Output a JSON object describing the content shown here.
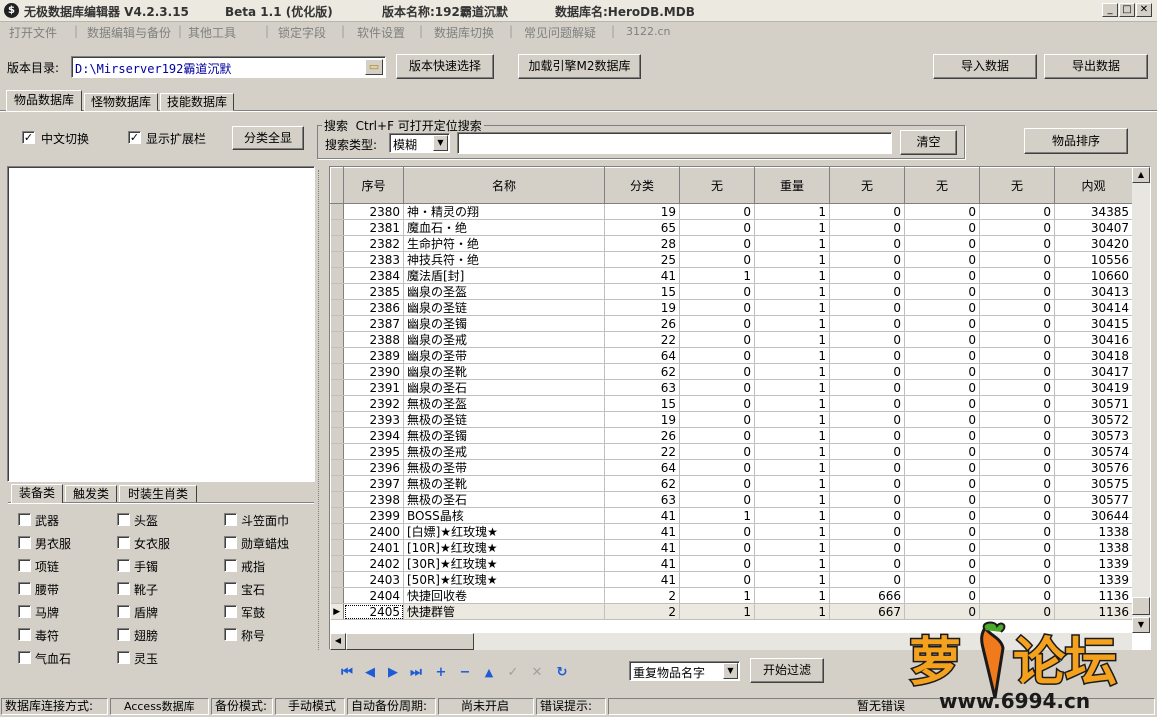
{
  "title": {
    "app_name": "无极数据库编辑器 V4.2.3.15",
    "beta": "Beta 1.1 (优化版)",
    "version_label": "版本名称:192霸道沉默",
    "db_label": "数据库名:HeroDB.MDB"
  },
  "menu": [
    "打开文件",
    "数据编辑与备份",
    "其他工具",
    "锁定字段",
    "软件设置",
    "数据库切换",
    "常见问题解疑",
    "3122.cn"
  ],
  "toolbar": {
    "dir_label": "版本目录:",
    "dir_value": "D:\\Mirserver192霸道沉默",
    "quick_select": "版本快速选择",
    "load_m2": "加载引擎M2数据库",
    "import": "导入数据",
    "export": "导出数据"
  },
  "tabs": [
    "物品数据库",
    "怪物数据库",
    "技能数据库"
  ],
  "options": {
    "chinese_switch": "中文切换",
    "show_ext": "显示扩展栏",
    "show_all": "分类全显"
  },
  "search": {
    "group_label": "搜索",
    "hint": "Ctrl+F 可打开定位搜索",
    "type_label": "搜索类型:",
    "type_value": "模糊",
    "query": "",
    "clear": "清空",
    "sort": "物品排序"
  },
  "category_tabs": [
    "装备类",
    "触发类",
    "时装生肖类"
  ],
  "categories": [
    [
      "武器",
      "头盔",
      "斗笠面巾"
    ],
    [
      "男衣服",
      "女衣服",
      "勋章蜡烛"
    ],
    [
      "项链",
      "手镯",
      "戒指"
    ],
    [
      "腰带",
      "靴子",
      "宝石"
    ],
    [
      "马牌",
      "盾牌",
      "军鼓"
    ],
    [
      "毒符",
      "翅膀",
      "称号"
    ],
    [
      "气血石",
      "灵玉",
      ""
    ]
  ],
  "grid": {
    "columns": [
      "序号",
      "名称",
      "分类",
      "无",
      "重量",
      "无",
      "无",
      "无",
      "内观"
    ],
    "rows": [
      [
        "2380",
        "神・精灵の翔",
        "19",
        "0",
        "1",
        "0",
        "0",
        "0",
        "34385"
      ],
      [
        "2381",
        "魔血石・绝",
        "65",
        "0",
        "1",
        "0",
        "0",
        "0",
        "30407"
      ],
      [
        "2382",
        "生命护符・绝",
        "28",
        "0",
        "1",
        "0",
        "0",
        "0",
        "30420"
      ],
      [
        "2383",
        "神技兵符・绝",
        "25",
        "0",
        "1",
        "0",
        "0",
        "0",
        "10556"
      ],
      [
        "2384",
        "魔法盾[封]",
        "41",
        "1",
        "1",
        "0",
        "0",
        "0",
        "10660"
      ],
      [
        "2385",
        "幽泉の圣盔",
        "15",
        "0",
        "1",
        "0",
        "0",
        "0",
        "30413"
      ],
      [
        "2386",
        "幽泉の圣链",
        "19",
        "0",
        "1",
        "0",
        "0",
        "0",
        "30414"
      ],
      [
        "2387",
        "幽泉の圣镯",
        "26",
        "0",
        "1",
        "0",
        "0",
        "0",
        "30415"
      ],
      [
        "2388",
        "幽泉の圣戒",
        "22",
        "0",
        "1",
        "0",
        "0",
        "0",
        "30416"
      ],
      [
        "2389",
        "幽泉の圣带",
        "64",
        "0",
        "1",
        "0",
        "0",
        "0",
        "30418"
      ],
      [
        "2390",
        "幽泉の圣靴",
        "62",
        "0",
        "1",
        "0",
        "0",
        "0",
        "30417"
      ],
      [
        "2391",
        "幽泉の圣石",
        "63",
        "0",
        "1",
        "0",
        "0",
        "0",
        "30419"
      ],
      [
        "2392",
        "無极の圣盔",
        "15",
        "0",
        "1",
        "0",
        "0",
        "0",
        "30571"
      ],
      [
        "2393",
        "無极の圣链",
        "19",
        "0",
        "1",
        "0",
        "0",
        "0",
        "30572"
      ],
      [
        "2394",
        "無极の圣镯",
        "26",
        "0",
        "1",
        "0",
        "0",
        "0",
        "30573"
      ],
      [
        "2395",
        "無极の圣戒",
        "22",
        "0",
        "1",
        "0",
        "0",
        "0",
        "30574"
      ],
      [
        "2396",
        "無极の圣带",
        "64",
        "0",
        "1",
        "0",
        "0",
        "0",
        "30576"
      ],
      [
        "2397",
        "無极の圣靴",
        "62",
        "0",
        "1",
        "0",
        "0",
        "0",
        "30575"
      ],
      [
        "2398",
        "無极の圣石",
        "63",
        "0",
        "1",
        "0",
        "0",
        "0",
        "30577"
      ],
      [
        "2399",
        "BOSS晶核",
        "41",
        "1",
        "1",
        "0",
        "0",
        "0",
        "30644"
      ],
      [
        "2400",
        "[白嫖]★红玫瑰★",
        "41",
        "0",
        "1",
        "0",
        "0",
        "0",
        "1338"
      ],
      [
        "2401",
        "[10R]★红玫瑰★",
        "41",
        "0",
        "1",
        "0",
        "0",
        "0",
        "1338"
      ],
      [
        "2402",
        "[30R]★红玫瑰★",
        "41",
        "0",
        "1",
        "0",
        "0",
        "0",
        "1339"
      ],
      [
        "2403",
        "[50R]★红玫瑰★",
        "41",
        "0",
        "1",
        "0",
        "0",
        "0",
        "1339"
      ],
      [
        "2404",
        "快捷回收卷",
        "2",
        "1",
        "1",
        "666",
        "0",
        "0",
        "1136"
      ],
      [
        "2405",
        "快捷群管",
        "2",
        "1",
        "1",
        "667",
        "0",
        "0",
        "1136"
      ]
    ],
    "selected_index": 25
  },
  "bottom": {
    "filter_value": "重复物品名字",
    "filter_button": "开始过滤"
  },
  "status": {
    "conn_label": "数据库连接方式:",
    "conn_value": "Access数据库",
    "backup_label": "备份模式:",
    "backup_value": "手动模式",
    "auto_label": "自动备份周期:",
    "auto_value": "尚未开启",
    "err_label": "错误提示:",
    "err_value": "暂无错误"
  },
  "watermark": {
    "brand": "萝卜论坛",
    "url": "www.6994.cn"
  },
  "colors": {
    "nav_blue": "#1e5bd6",
    "brand_orange": "#f07a1c"
  }
}
